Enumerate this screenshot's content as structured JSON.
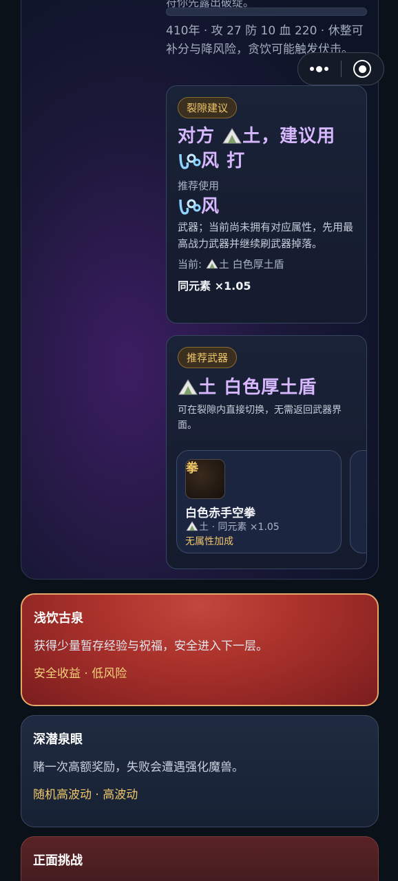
{
  "header": {
    "truncated_text": "符你先露出破绽。",
    "progress": 0.0,
    "stats_line": "410年 · 攻 27 防 10 血 220 · 休整可补分与降风险，贪饮可能触发伏击。"
  },
  "capsule": {
    "more_icon": "more-dots-icon",
    "close_icon": "target-circle-icon"
  },
  "suggestion": {
    "badge": "裂隙建议",
    "headline_prefix": "对方",
    "headline_enemy_element": "土",
    "headline_mid": "，建议用",
    "headline_use_element": "风",
    "headline_action": "打",
    "recommend_label": "推荐使用",
    "recommend_element": "风",
    "note": "武器；当前尚未拥有对应属性，先用最高战力武器并继续刷武器掉落。",
    "current_prefix": "当前:",
    "current_element": "土",
    "current_weapon": "白色厚土盾",
    "multiplier": "同元素 ×1.05"
  },
  "weapon": {
    "badge": "推荐武器",
    "element": "土",
    "name": "白色厚土盾",
    "note": "可在裂隙内直接切换，无需返回武器界面。",
    "item": {
      "tag": "拳",
      "name": "白色赤手空拳",
      "element": "土",
      "sub": "· 同元素 ×1.05",
      "bonus": "无属性加成"
    }
  },
  "routes": [
    {
      "title": "浅饮古泉",
      "desc": "获得少量暂存经验与祝福，安全进入下一层。",
      "tags": "安全收益 · 低风险"
    },
    {
      "title": "深潜泉眼",
      "desc": "赌一次高额奖励，失败会遭遇强化魔兽。",
      "tags": "随机高波动 · 高波动"
    },
    {
      "title": "正面挑战"
    }
  ],
  "colors": {
    "accent_gold": "#f0c66a",
    "headline_purple": "#d7b8ff",
    "selected_border": "#e8a86a"
  }
}
